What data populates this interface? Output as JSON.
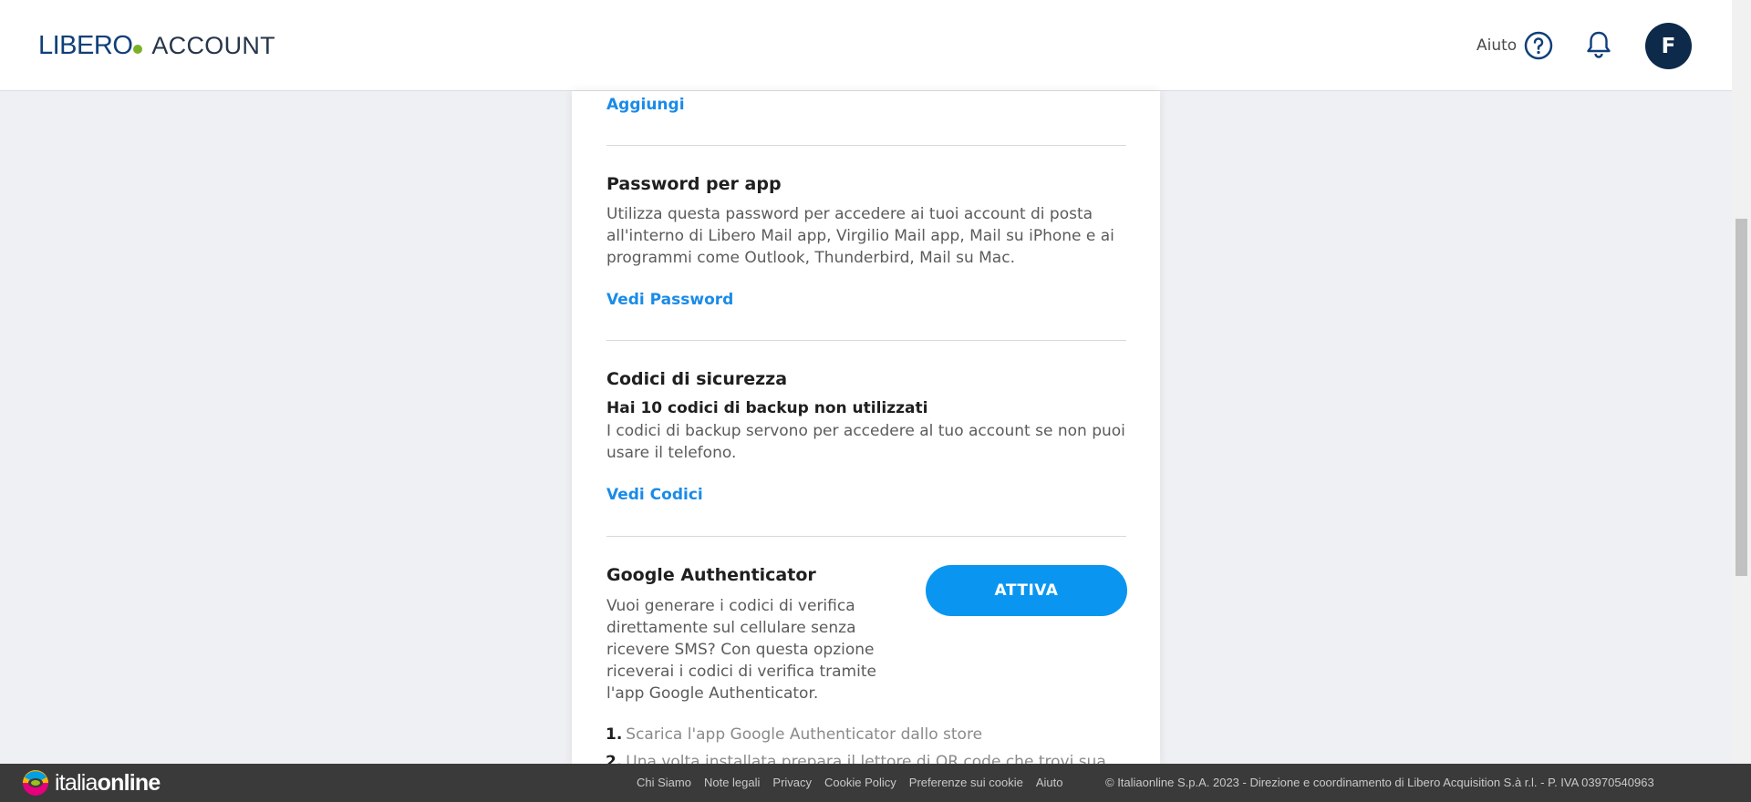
{
  "header": {
    "brand": "LIBERO",
    "product": "ACCOUNT",
    "help_label": "Aiuto",
    "avatar_initial": "F"
  },
  "card": {
    "add_link": "Aggiungi",
    "app_password": {
      "title": "Password per app",
      "description": "Utilizza questa password per accedere ai tuoi account di posta all'interno di Libero Mail app, Virgilio Mail app, Mail su iPhone e ai programmi come Outlook, Thunderbird, Mail su Mac.",
      "link": "Vedi Password"
    },
    "security_codes": {
      "title": "Codici di sicurezza",
      "subtitle": "Hai 10 codici di backup non utilizzati",
      "description": "I codici di backup servono per accedere al tuo account se non puoi usare il telefono.",
      "link": "Vedi Codici"
    },
    "google_auth": {
      "title": "Google Authenticator",
      "description": "Vuoi generare i codici di verifica direttamente sul cellulare senza ricevere SMS? Con questa opzione riceverai i codici di verifica tramite l'app Google Authenticator.",
      "button": "ATTIVA",
      "steps": [
        {
          "num": "1.",
          "text": "Scarica l'app Google Authenticator dallo store"
        },
        {
          "num": "2.",
          "text": "Una volta installata prepara il lettore di QR code che trovi sua"
        }
      ]
    }
  },
  "footer": {
    "logo_light": "italia",
    "logo_bold": "online",
    "links": [
      "Chi Siamo",
      "Note legali",
      "Privacy",
      "Cookie Policy",
      "Preferenze sui cookie",
      "Aiuto"
    ],
    "copyright": "© Italiaonline S.p.A. 2023  -  Direzione e coordinamento di Libero Acquisition S.à r.l.  -  P. IVA 03970540963"
  },
  "colors": {
    "brand_blue": "#0f3f7a",
    "brand_green": "#7bb127",
    "link_blue": "#1a8be8",
    "button_blue": "#0a96f0",
    "avatar_bg": "#0d2a4a",
    "footer_bg": "#3a3a3a"
  }
}
